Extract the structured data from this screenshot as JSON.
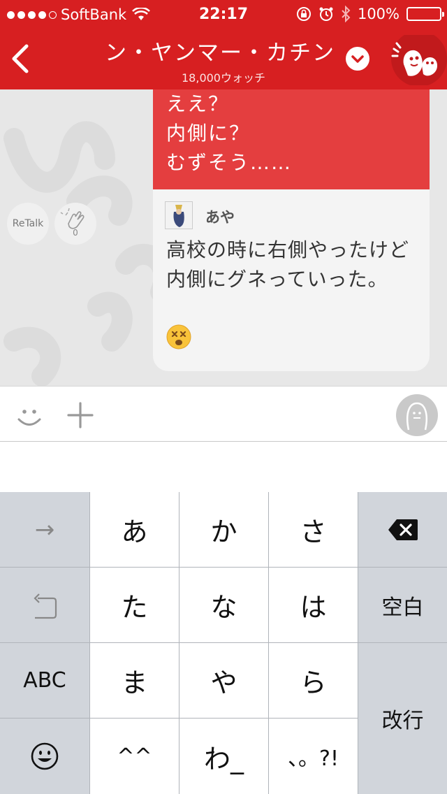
{
  "status_bar": {
    "carrier": "SoftBank",
    "time": "22:17",
    "battery": "100%",
    "signal_bars": 4,
    "battery_level": 1.0
  },
  "nav": {
    "title": "ン・ヤンマー・カチン",
    "subtitle": "18,000ウォッチ"
  },
  "colors": {
    "brand_red": "#d71f21",
    "quote_red": "#e43e3f",
    "keyboard_gray": "#d1d5db"
  },
  "message": {
    "quoted_text": "ええ？\n内側に？\nむずそう……",
    "reply_user": "あや",
    "reply_text": "高校の時に右側やったけど\n内側にグネっていった。",
    "reply_emoji": "dizzy-face-icon",
    "retalk_label": "ReTalk",
    "clap_count": "0"
  },
  "input_bar": {
    "icons": [
      "smile-icon",
      "plus-icon",
      "speech-face-icon"
    ]
  },
  "keyboard": {
    "row1": [
      "→",
      "あ",
      "か",
      "さ",
      "delete"
    ],
    "row2": [
      "undo",
      "た",
      "な",
      "は",
      "空白"
    ],
    "row3": [
      "ABC",
      "ま",
      "や",
      "ら",
      "改行"
    ],
    "row4": [
      "emoji",
      "^^",
      "わ_",
      "、。?!"
    ]
  }
}
